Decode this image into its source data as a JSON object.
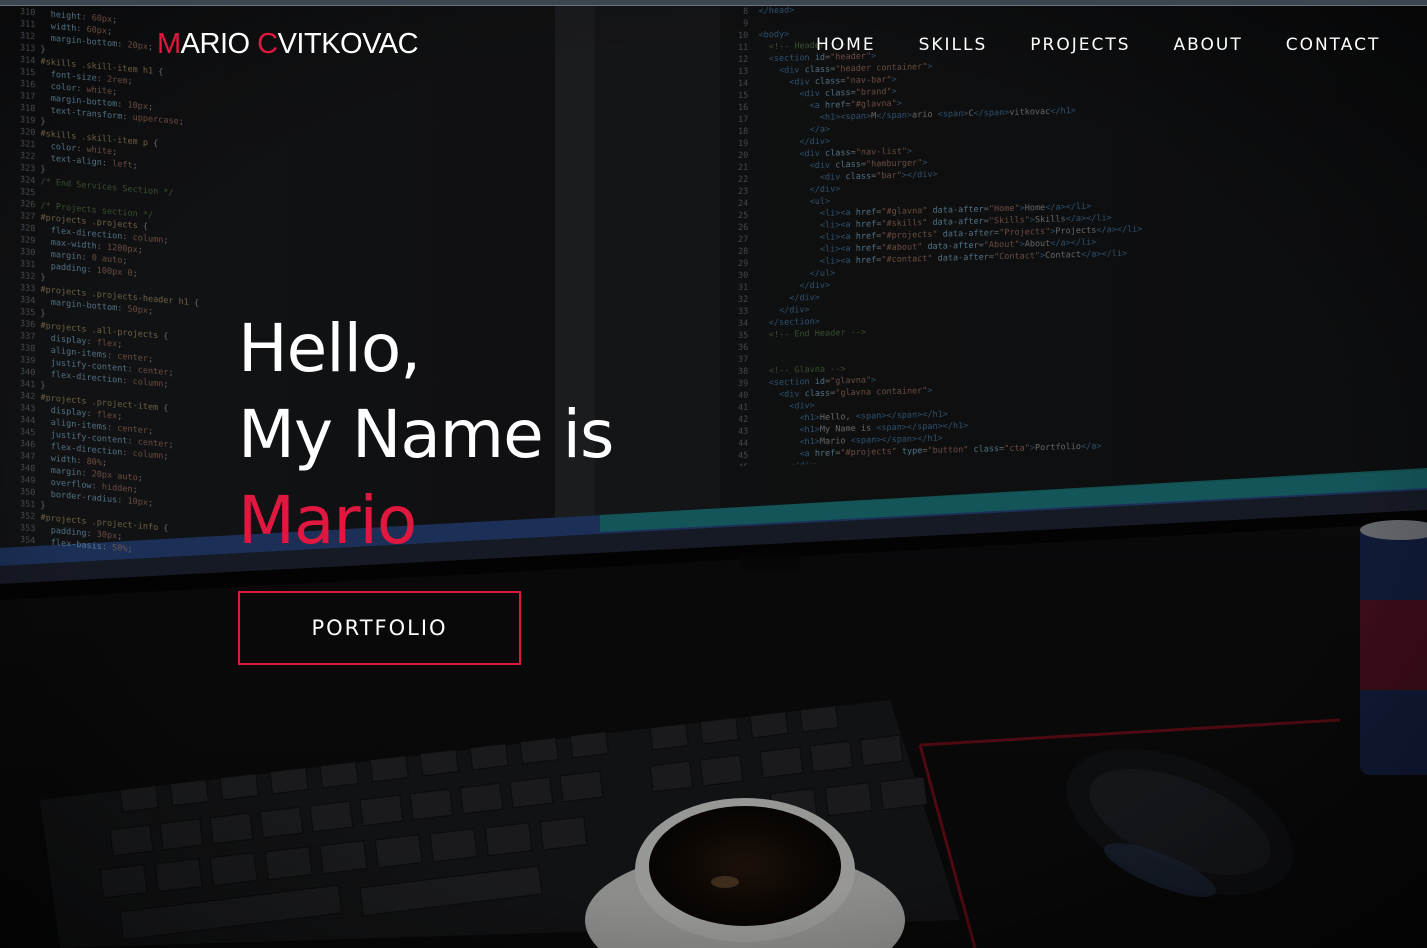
{
  "header": {
    "brand_first_initial": "M",
    "brand_first_rest": "ARIO ",
    "brand_last_initial": "C",
    "brand_last_rest": "VITKOVAC",
    "nav": [
      {
        "label": "HOME"
      },
      {
        "label": "SKILLS"
      },
      {
        "label": "PROJECTS"
      },
      {
        "label": "ABOUT"
      },
      {
        "label": "CONTACT"
      }
    ]
  },
  "intro": {
    "line1": "Hello,",
    "line2": "My Name is",
    "name": "Mario",
    "cta_label": "PORTFOLIO"
  },
  "colors": {
    "accent": "#e0173f",
    "text": "#ffffff",
    "background": "#0a0a0c"
  }
}
